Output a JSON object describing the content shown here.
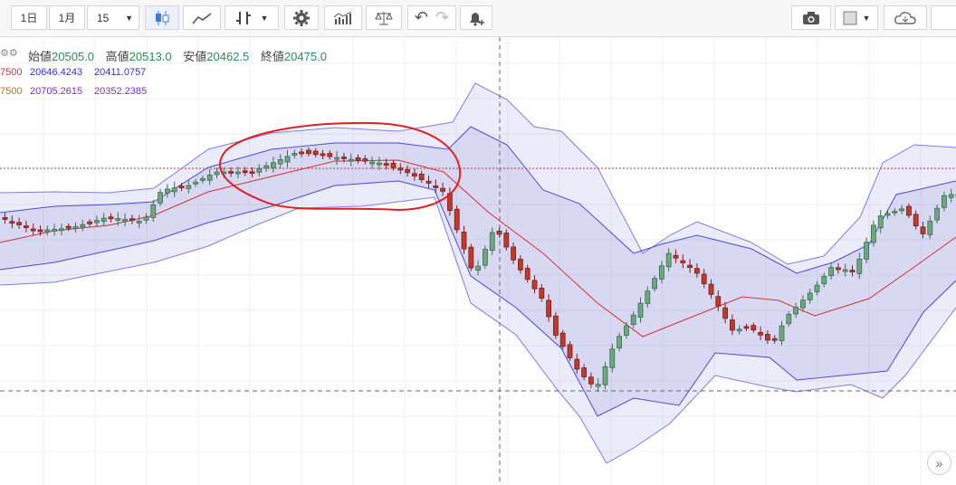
{
  "toolbar": {
    "interval_day": "1日",
    "interval_month": "1月",
    "interval_minutes": "15",
    "icons": [
      "candles-icon",
      "line-chart-icon",
      "bar-ohlc-icon",
      "gear-icon",
      "indicators-icon",
      "balance-icon",
      "undo-icon",
      "redo-icon",
      "alert-bell-icon",
      "camera-icon",
      "square-icon",
      "cloud-icon"
    ]
  },
  "legend": {
    "open_label": "始値",
    "open": "20505.0",
    "high_label": "高値",
    "high": "20513.0",
    "low_label": "安値",
    "low": "20462.5",
    "close_label": "終値",
    "close": "20475.0",
    "bb1_prefix": "7500",
    "bb1_upper": "20646.4243",
    "bb1_lower": "20411.0757",
    "bb2_prefix": "7500",
    "bb2_upper": "20705.2615",
    "bb2_lower": "20352.2385"
  },
  "expand_label": "»",
  "colors": {
    "up": "#6ba87f",
    "down": "#c0392b",
    "band": "#4b4bd6",
    "sma": "#d63030",
    "annotation": "#e02020"
  },
  "chart_data": {
    "type": "candlestick",
    "title": "",
    "indicators": [
      "Bollinger Bands 1σ",
      "Bollinger Bands 2σ",
      "SMA"
    ],
    "grid": true,
    "last_candle": {
      "open": 20505.0,
      "high": 20513.0,
      "low": 20462.5,
      "close": 20475.0
    },
    "bands_last": {
      "upper_1": 20646.4243,
      "lower_1": 20411.0757,
      "upper_2": 20705.2615,
      "lower_2": 20352.2385
    },
    "annotation": "red-hand-drawn-ellipse"
  }
}
